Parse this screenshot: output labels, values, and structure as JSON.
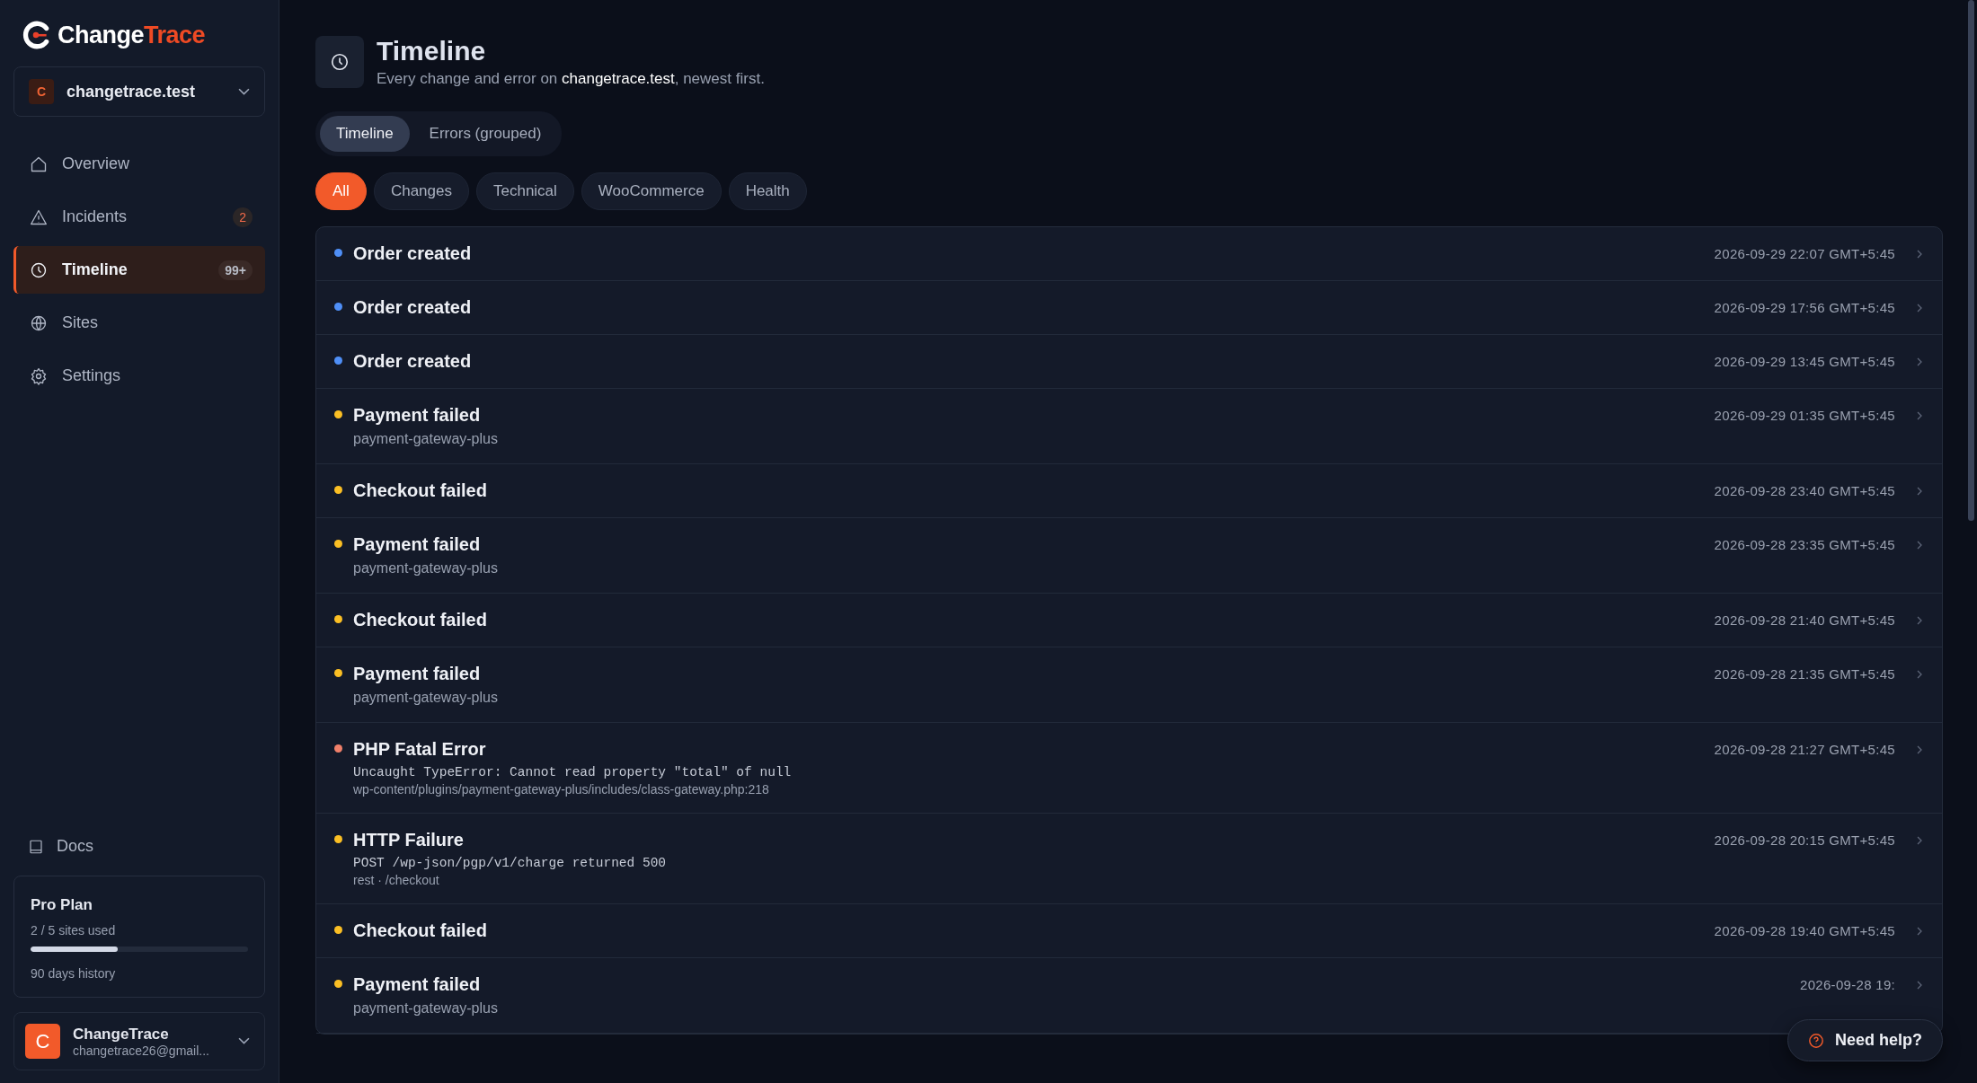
{
  "brand": {
    "name_part_1": "Change",
    "name_part_2": "Trace"
  },
  "site_switcher": {
    "initial": "C",
    "name": "changetrace.test"
  },
  "nav": [
    {
      "label": "Overview",
      "selected": false
    },
    {
      "label": "Incidents",
      "badge": "2",
      "selected": false
    },
    {
      "label": "Timeline",
      "badge": "99+",
      "selected": true
    },
    {
      "label": "Sites",
      "selected": false
    },
    {
      "label": "Settings",
      "selected": false
    }
  ],
  "docs_link": "Docs",
  "plan": {
    "title": "Pro Plan",
    "usage": "2 / 5 sites used",
    "level": 0.4,
    "history": "90 days history"
  },
  "account": {
    "initial": "C",
    "name": "ChangeTrace",
    "email": "changetrace26@gmail..."
  },
  "header": {
    "title": "Timeline",
    "subtitle": "Every change and error on **changetrace.test**, newest first."
  },
  "view_tabs": [
    {
      "label": "Timeline",
      "selected": true
    },
    {
      "label": "Errors (grouped)",
      "selected": false
    }
  ],
  "filters": [
    {
      "label": "All",
      "selected": true
    },
    {
      "label": "Changes",
      "selected": false
    },
    {
      "label": "Technical",
      "selected": false
    },
    {
      "label": "WooCommerce",
      "selected": false
    },
    {
      "label": "Health",
      "selected": false
    }
  ],
  "events": [
    {
      "title": "Order created",
      "time": "2026-09-29 22:07 GMT+5:45",
      "color": "#4f8ff7"
    },
    {
      "title": "Order created",
      "time": "2026-09-29 17:56 GMT+5:45",
      "color": "#4f8ff7"
    },
    {
      "title": "Order created",
      "time": "2026-09-29 13:45 GMT+5:45",
      "color": "#4f8ff7"
    },
    {
      "title": "Payment failed",
      "sub": "payment-gateway-plus",
      "time": "2026-09-29 01:35 GMT+5:45",
      "color": "#fbbf24"
    },
    {
      "title": "Checkout failed",
      "time": "2026-09-28 23:40 GMT+5:45",
      "color": "#fbbf24"
    },
    {
      "title": "Payment failed",
      "sub": "payment-gateway-plus",
      "time": "2026-09-28 23:35 GMT+5:45",
      "color": "#fbbf24"
    },
    {
      "title": "Checkout failed",
      "time": "2026-09-28 21:40 GMT+5:45",
      "color": "#fbbf24"
    },
    {
      "title": "Payment failed",
      "sub": "payment-gateway-plus",
      "time": "2026-09-28 21:35 GMT+5:45",
      "color": "#fbbf24"
    },
    {
      "title": "PHP Fatal Error",
      "code": "Uncaught TypeError: Cannot read property \"total\" of null",
      "sub": "wp-content/plugins/payment-gateway-plus/includes/class-gateway.php:218",
      "time": "2026-09-28 21:27 GMT+5:45",
      "color": "#f0806a"
    },
    {
      "title": "HTTP Failure",
      "code": "POST /wp-json/pgp/v1/charge returned 500",
      "sub": "rest · /checkout",
      "time": "2026-09-28 20:15 GMT+5:45",
      "color": "#fbbf24"
    },
    {
      "title": "Checkout failed",
      "time": "2026-09-28 19:40 GMT+5:45",
      "color": "#fbbf24"
    },
    {
      "title": "Payment failed",
      "sub": "payment-gateway-plus",
      "time": "2026-09-28 19:",
      "color": "#fbbf24"
    }
  ],
  "help_button": "Need help?"
}
